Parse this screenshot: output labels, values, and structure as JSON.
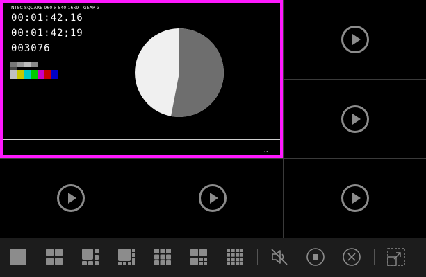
{
  "active_feed": {
    "header": "NTSC SQUARE  960 x 540  16x9  -  GEAR 3",
    "timecode_1": "00:01:42.16",
    "timecode_2": "00:01:42;19",
    "frame_count": "003076",
    "corner_mark": "◂ ◂",
    "pie_split": 0.53
  },
  "tiles": [
    {
      "icon": "play-icon"
    },
    {
      "icon": "play-icon"
    },
    {
      "icon": "play-icon"
    },
    {
      "icon": "play-icon"
    },
    {
      "icon": "play-icon"
    }
  ],
  "colors": {
    "active_border": "#ff19ff",
    "toolbar_bg": "#1c1c1c",
    "icon": "#8c8c8c"
  },
  "toolbar": {
    "buttons": [
      "layout-1x1-icon",
      "layout-2x2-icon",
      "layout-1plus3-icon",
      "layout-1plus5-icon",
      "layout-3x3-icon",
      "layout-1plus7-icon",
      "layout-4x4-icon",
      "mute-icon",
      "stop-icon",
      "close-icon",
      "fullscreen-icon"
    ]
  }
}
